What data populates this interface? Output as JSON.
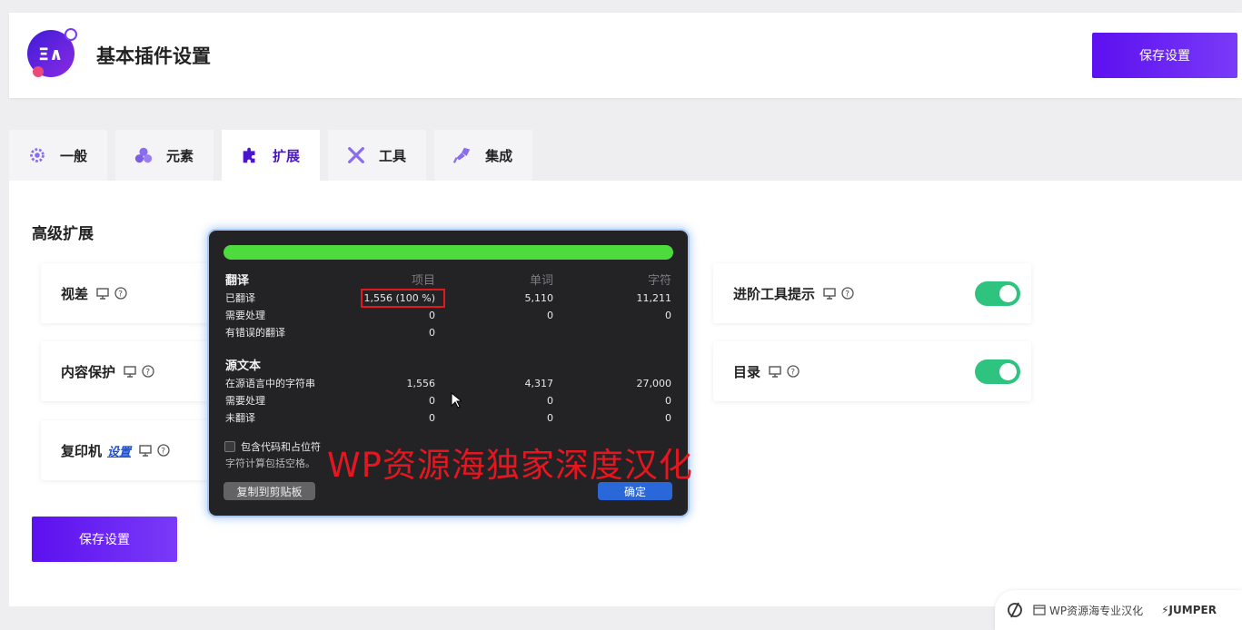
{
  "header": {
    "title": "基本插件设置",
    "save_label": "保存设置"
  },
  "tabs": [
    {
      "label": "一般",
      "icon": "gear-icon"
    },
    {
      "label": "元素",
      "icon": "elements-icon"
    },
    {
      "label": "扩展",
      "icon": "puzzle-icon",
      "active": true
    },
    {
      "label": "工具",
      "icon": "tools-icon"
    },
    {
      "label": "集成",
      "icon": "plug-icon"
    }
  ],
  "section": {
    "title": "高级扩展"
  },
  "cards": {
    "parallax": {
      "label": "视差"
    },
    "content_protect": {
      "label": "内容保护"
    },
    "duplicator": {
      "label": "复印机",
      "link": "设置"
    },
    "advanced_tooltip": {
      "label": "进阶工具提示",
      "enabled": true
    },
    "toc": {
      "label": "目录",
      "enabled": true
    }
  },
  "save_bottom_label": "保存设置",
  "dialog": {
    "progress_percent": 100,
    "head": {
      "c0": "翻译",
      "c1": "项目",
      "c2": "单词",
      "c3": "字符"
    },
    "translated": {
      "c0": "已翻译",
      "c1": "1,556 (100 %)",
      "c2": "5,110",
      "c3": "11,211"
    },
    "needs_work": {
      "c0": "需要处理",
      "c1": "0",
      "c2": "0",
      "c3": "0"
    },
    "errors": {
      "c0": "有错误的翻译",
      "c1": "0"
    },
    "source_head": {
      "c0": "源文本"
    },
    "source_strings": {
      "c0": "在源语言中的字符串",
      "c1": "1,556",
      "c2": "4,317",
      "c3": "27,000"
    },
    "source_needs": {
      "c0": "需要处理",
      "c1": "0",
      "c2": "0",
      "c3": "0"
    },
    "untranslated": {
      "c0": "未翻译",
      "c1": "0",
      "c2": "0",
      "c3": "0"
    },
    "checkbox_label": "包含代码和占位符",
    "note": "字符计算包括空格。",
    "copy_label": "复制到剪贴板",
    "ok_label": "确定"
  },
  "watermark": "WP资源海独家深度汉化",
  "footer": {
    "site_label": "WP资源海专业汉化",
    "brand": "JUMPER"
  },
  "colors": {
    "accent": "#5c10ef",
    "toggle_on": "#2ec47f",
    "progress": "#4ddb3e"
  }
}
